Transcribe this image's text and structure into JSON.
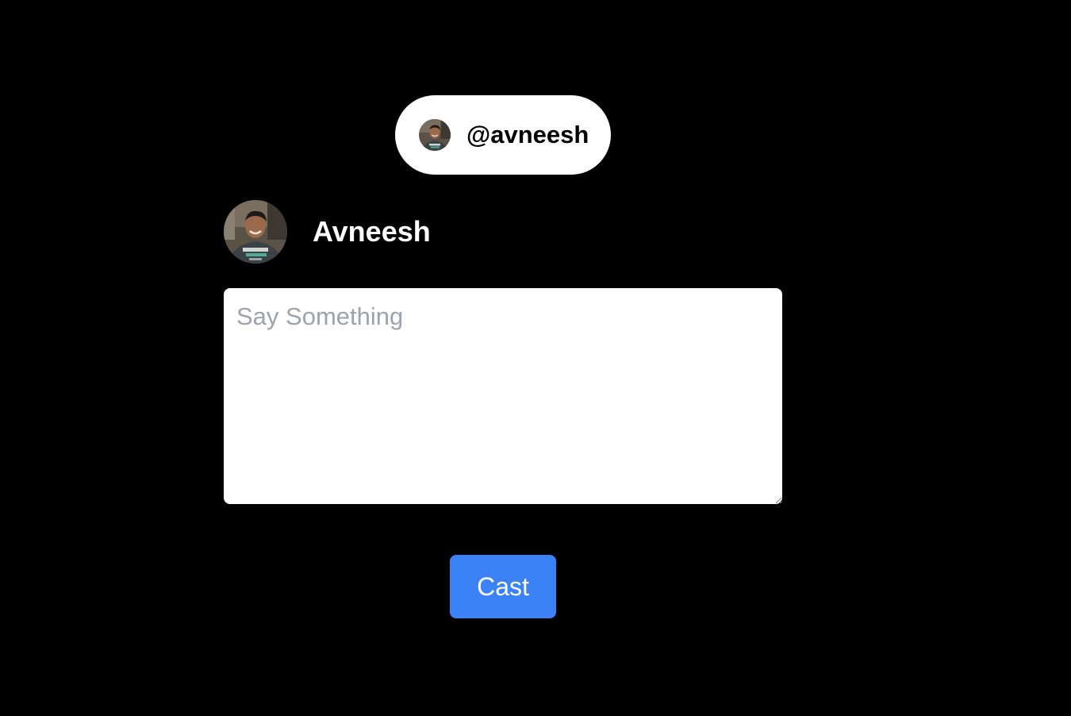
{
  "user": {
    "handle": "@avneesh",
    "display_name": "Avneesh",
    "avatar": "profile-photo"
  },
  "composer": {
    "placeholder": "Say Something",
    "value": ""
  },
  "actions": {
    "cast_label": "Cast"
  },
  "colors": {
    "background": "#000000",
    "pill": "#ffffff",
    "accent": "#3b82f6",
    "placeholder": "#9ca3af"
  }
}
